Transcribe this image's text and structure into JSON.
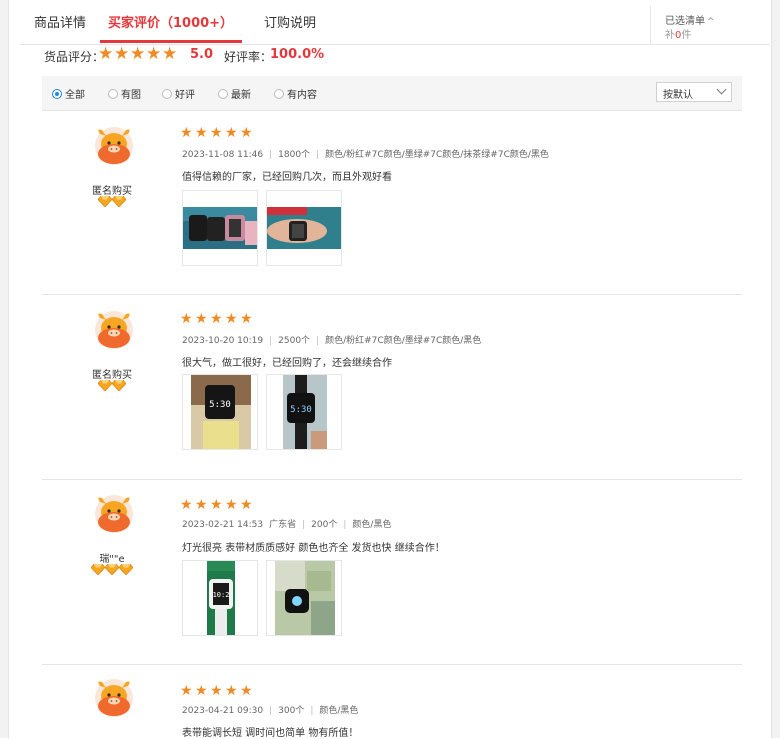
{
  "tabs": {
    "detail": "商品详情",
    "reviews": "买家评价（1000+）",
    "order": "订购说明"
  },
  "cart": {
    "title": "已选清单",
    "count_prefix": "补",
    "count": "0",
    "count_suffix": "件"
  },
  "summary": {
    "label": "货品评分：",
    "score": "5.0",
    "rate_label": "好评率：",
    "rate": "100.0%",
    "stars": 5
  },
  "filters": {
    "items": [
      "全部",
      "有图",
      "好评",
      "最新",
      "有内容"
    ],
    "selected": "全部",
    "sort": "按默认"
  },
  "reviews": [
    {
      "user": "匿名购买",
      "badges": 2,
      "stars": 5,
      "date": "2023-11-08 11:46",
      "location": "",
      "qty": "1800个",
      "spec": "颜色/粉红#7C颜色/墨绿#7C颜色/抹茶绿#7C颜色/黑色",
      "text": "值得信赖的厂家，已经回购几次，而且外观好看"
    },
    {
      "user": "匿名购买",
      "badges": 2,
      "stars": 5,
      "date": "2023-10-20 10:19",
      "location": "",
      "qty": "2500个",
      "spec": "颜色/粉红#7C颜色/墨绿#7C颜色/黑色",
      "text": "很大气，做工很好，已经回购了，还会继续合作"
    },
    {
      "user": "瑞\"\"e",
      "badges": 3,
      "stars": 5,
      "date": "2023-02-21 14:53",
      "location": "广东省",
      "qty": "200个",
      "spec": "颜色/黑色",
      "text": "灯光很亮 表带材质质感好 颜色也齐全 发货也快 继续合作！"
    },
    {
      "user": "",
      "badges": 0,
      "stars": 5,
      "date": "2023-04-21 09:30",
      "location": "",
      "qty": "300个",
      "spec": "颜色/黑色",
      "text": "表带能调长短 调时间也简单 物有所值！"
    }
  ],
  "colors": {
    "accent": "#e4393c",
    "star": "#f08a24",
    "diamond": "#f5a623"
  }
}
